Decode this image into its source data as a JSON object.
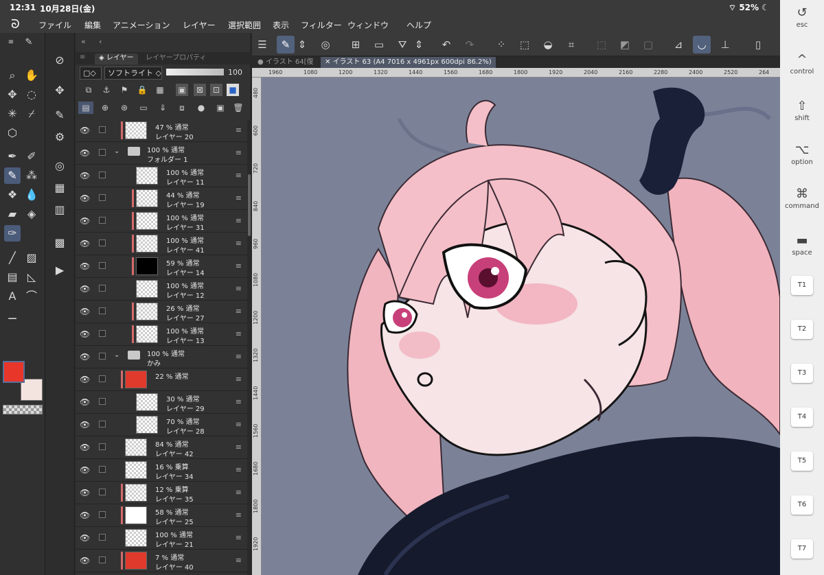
{
  "status": {
    "time": "12:31",
    "date": "10月28日(金)",
    "battery": "52%"
  },
  "menu": [
    "ファイル",
    "編集",
    "アニメーション",
    "レイヤー",
    "選択範囲",
    "表示",
    "フィルター",
    "ウィンドウ",
    "ヘルプ"
  ],
  "layer_panel": {
    "tabs": [
      "レイヤー",
      "レイヤープロパティ"
    ],
    "blend_mode": "ソフトライト",
    "opacity": "100",
    "layers": [
      {
        "mode": "47 % 通常",
        "name": "レイヤー 20",
        "indent": 0,
        "thumb": "checker",
        "bar": true
      },
      {
        "mode": "100 % 通常",
        "name": "フォルダー 1",
        "indent": 0,
        "folder": true,
        "open": true
      },
      {
        "mode": "100 % 通常",
        "name": "レイヤー 11",
        "indent": 1,
        "thumb": "checker"
      },
      {
        "mode": "44 % 通常",
        "name": "レイヤー 19",
        "indent": 1,
        "thumb": "checker",
        "bar": true
      },
      {
        "mode": "100 % 通常",
        "name": "レイヤー 31",
        "indent": 1,
        "thumb": "checker",
        "bar": true
      },
      {
        "mode": "100 % 通常",
        "name": "レイヤー 41",
        "indent": 1,
        "thumb": "checker",
        "bar": true
      },
      {
        "mode": "59 % 通常",
        "name": "レイヤー 14",
        "indent": 1,
        "thumb": "black",
        "bar": true
      },
      {
        "mode": "100 % 通常",
        "name": "レイヤー 12",
        "indent": 1,
        "thumb": "checker"
      },
      {
        "mode": "26 % 通常",
        "name": "レイヤー 27",
        "indent": 1,
        "thumb": "checker",
        "bar": true
      },
      {
        "mode": "100 % 通常",
        "name": "レイヤー 13",
        "indent": 1,
        "thumb": "checker",
        "bar": true
      },
      {
        "mode": "100 % 通常",
        "name": "かみ",
        "indent": 0,
        "folder": true,
        "open": true
      },
      {
        "mode": "22 % 通常",
        "name": "",
        "indent": 0,
        "thumb": "red",
        "bar": true
      },
      {
        "mode": "30 % 通常",
        "name": "レイヤー 29",
        "indent": 1,
        "thumb": "checker"
      },
      {
        "mode": "70 % 通常",
        "name": "レイヤー 28",
        "indent": 1,
        "thumb": "checker"
      },
      {
        "mode": "84 % 通常",
        "name": "レイヤー 42",
        "indent": 0,
        "thumb": "checker"
      },
      {
        "mode": "16 % 乗算",
        "name": "レイヤー 34",
        "indent": 0,
        "thumb": "checker"
      },
      {
        "mode": "12 % 乗算",
        "name": "レイヤー 35",
        "indent": 0,
        "thumb": "checker",
        "bar": true
      },
      {
        "mode": "58 % 通常",
        "name": "レイヤー 25",
        "indent": 0,
        "thumb": "white",
        "bar": true
      },
      {
        "mode": "100 % 通常",
        "name": "レイヤー 21",
        "indent": 0,
        "thumb": "checker"
      },
      {
        "mode": "7 % 通常",
        "name": "レイヤー 40",
        "indent": 0,
        "thumb": "red",
        "bar": true
      }
    ]
  },
  "doc_tabs": [
    "イラスト 64[復",
    "イラスト 63 (A4 7016 x 4961px 600dpi 86.2%)"
  ],
  "ruler_top": [
    "1960",
    "1080",
    "1200",
    "1320",
    "1440",
    "1560",
    "1680",
    "1800",
    "1920",
    "2040",
    "2160",
    "2280",
    "2400",
    "2520",
    "264"
  ],
  "ruler_left": [
    "480",
    "600",
    "720",
    "840",
    "960",
    "1080",
    "1200",
    "1320",
    "1440",
    "1560",
    "1680",
    "1800",
    "1920",
    "2040"
  ],
  "shortcuts": {
    "esc": "esc",
    "control": "control",
    "shift": "shift",
    "option": "option",
    "command": "command",
    "space": "space",
    "tkeys": [
      "T1",
      "T2",
      "T3",
      "T4",
      "T5",
      "T6",
      "T7"
    ]
  },
  "colors": {
    "main": "#e8362a",
    "sub": "#f4e4df",
    "canvas_bg": "#7b8298",
    "hair": "#f2b8c0",
    "eye": "#c8407a",
    "jacket": "#151a2c"
  }
}
